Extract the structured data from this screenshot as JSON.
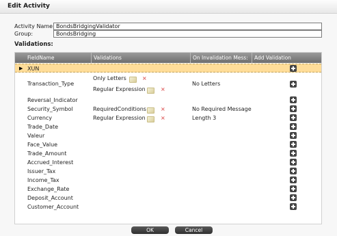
{
  "dialog": {
    "title": "Edit Activity"
  },
  "form": {
    "activity_name_label": "Activity Name:",
    "activity_name_value": "BondsBridgingValidator",
    "group_label": "Group:",
    "group_value": "BondsBridging"
  },
  "validations": {
    "section_label": "Validations:",
    "columns": [
      "FieldName",
      "Validations",
      "On Invalidation Mess:",
      "Add Validation"
    ],
    "rows": [
      {
        "field": "XUN",
        "selected": true
      },
      {
        "field": "Transaction_Type",
        "validations": [
          "Only Letters",
          "Regular Expression"
        ],
        "message": "No Letters"
      },
      {
        "field": "Reversal_Indicator"
      },
      {
        "field": "Security_Symbol",
        "validations": [
          "RequiredConditions"
        ],
        "message": "No Required Message"
      },
      {
        "field": "Currency",
        "validations": [
          "Regular Expression"
        ],
        "message": "Length 3"
      },
      {
        "field": "Trade_Date"
      },
      {
        "field": "Valeur"
      },
      {
        "field": "Face_Value"
      },
      {
        "field": "Trade_Amount"
      },
      {
        "field": "Accrued_Interest"
      },
      {
        "field": "Issuer_Tax"
      },
      {
        "field": "Income_Tax"
      },
      {
        "field": "Exchange_Rate"
      },
      {
        "field": "Deposit_Account"
      },
      {
        "field": "Customer_Account"
      }
    ]
  },
  "buttons": {
    "ok": "OK",
    "cancel": "Cancel"
  },
  "colors": {
    "selected_row": "#ffdd99",
    "header": "#7a7a7a",
    "button": "#3c3c3c"
  }
}
